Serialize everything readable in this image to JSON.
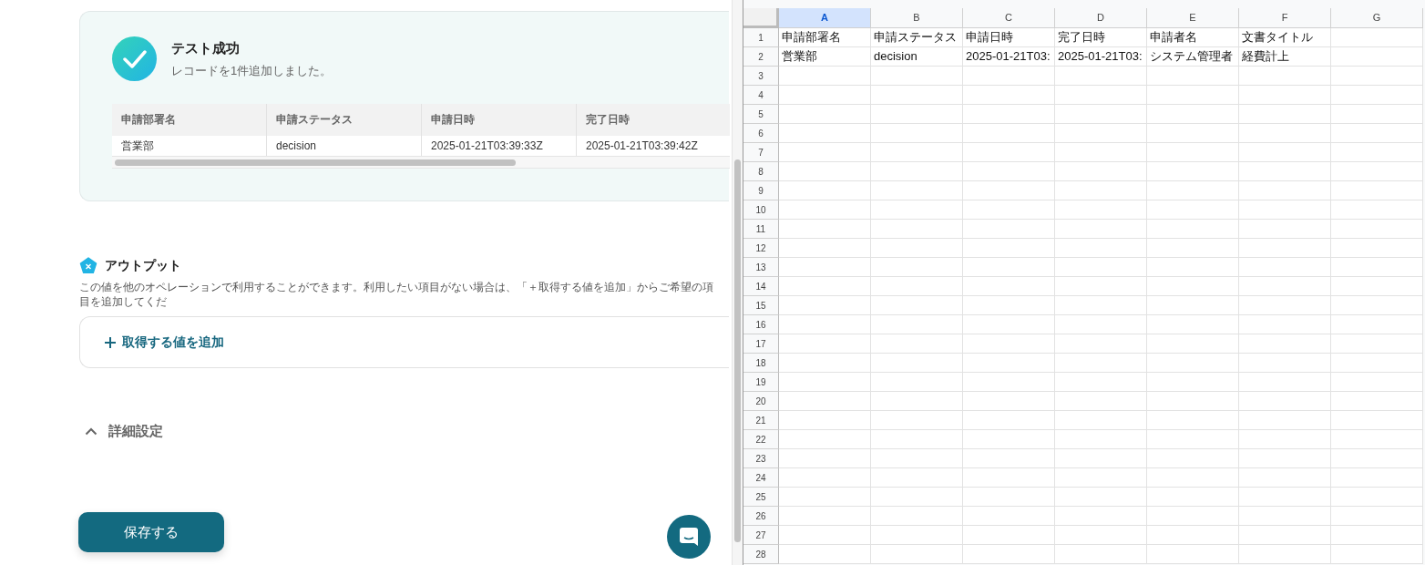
{
  "test_result": {
    "title": "テスト成功",
    "message": "レコードを1件追加しました。",
    "table": {
      "columns": [
        "申請部署名",
        "申請ステータス",
        "申請日時",
        "完了日時"
      ],
      "rows": [
        [
          "営業部",
          "decision",
          "2025-01-21T03:39:33Z",
          "2025-01-21T03:39:42Z"
        ]
      ]
    }
  },
  "output": {
    "title": "アウトプット",
    "description": "この値を他のオペレーションで利用することができます。利用したい項目がない場合は、「＋取得する値を追加」からご希望の項目を追加してくだ",
    "add_button": "取得する値を追加"
  },
  "advanced": {
    "label": "詳細設定",
    "expanded": true
  },
  "save_button": "保存する",
  "spreadsheet": {
    "columns": [
      {
        "label": "A",
        "selected": true
      },
      {
        "label": "B",
        "selected": false
      },
      {
        "label": "C",
        "selected": false
      },
      {
        "label": "D",
        "selected": false
      },
      {
        "label": "E",
        "selected": false
      },
      {
        "label": "F",
        "selected": false
      },
      {
        "label": "G",
        "selected": false
      }
    ],
    "rows": [
      {
        "number": "1",
        "cells": [
          "申請部署名",
          "申請ステータス",
          "申請日時",
          "完了日時",
          "申請者名",
          "文書タイトル"
        ]
      },
      {
        "number": "2",
        "cells": [
          "営業部",
          "decision",
          "2025-01-21T03:",
          "2025-01-21T03:",
          "システム管理者",
          "経費計上"
        ]
      },
      {
        "number": "3"
      },
      {
        "number": "4"
      },
      {
        "number": "5"
      },
      {
        "number": "6"
      },
      {
        "number": "7"
      },
      {
        "number": "8"
      },
      {
        "number": "9"
      },
      {
        "number": "10"
      },
      {
        "number": "11"
      },
      {
        "number": "12"
      },
      {
        "number": "13"
      },
      {
        "number": "14"
      },
      {
        "number": "15"
      },
      {
        "number": "16"
      },
      {
        "number": "17"
      },
      {
        "number": "18"
      },
      {
        "number": "19"
      },
      {
        "number": "20"
      },
      {
        "number": "21"
      },
      {
        "number": "22"
      },
      {
        "number": "23"
      },
      {
        "number": "24"
      },
      {
        "number": "25"
      },
      {
        "number": "26"
      },
      {
        "number": "27"
      },
      {
        "number": "28"
      }
    ]
  }
}
